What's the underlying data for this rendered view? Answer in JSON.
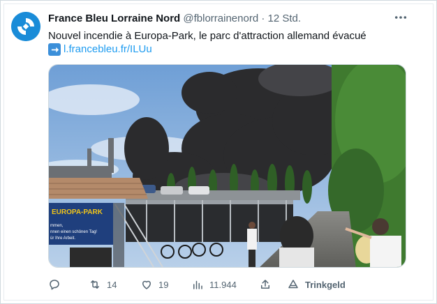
{
  "tweet": {
    "author_name": "France Bleu Lorraine Nord",
    "handle": "@fblorrainenord",
    "separator": "·",
    "time": "12 Std.",
    "text": "Nouvel incendie à Europa-Park, le parc d'attraction allemand évacué",
    "link": "l.francebleu.fr/ILUu",
    "more_icon": "more-horizontal-icon",
    "link_prefix_icon": "right-arrow-emoji-icon"
  },
  "media": {
    "sign_text": "EUROPA-PARK",
    "sign_lines": [
      "mmen,",
      "nnen einen schönen Tag!",
      "ür Ihre Arbeit."
    ]
  },
  "actions": {
    "reply_count": "",
    "retweet_count": "14",
    "like_count": "19",
    "views_count": "11.944",
    "tip_label": "Trinkgeld"
  },
  "colors": {
    "brand": "#1a8cd8",
    "link": "#1d9bf0",
    "muted": "#536471"
  }
}
